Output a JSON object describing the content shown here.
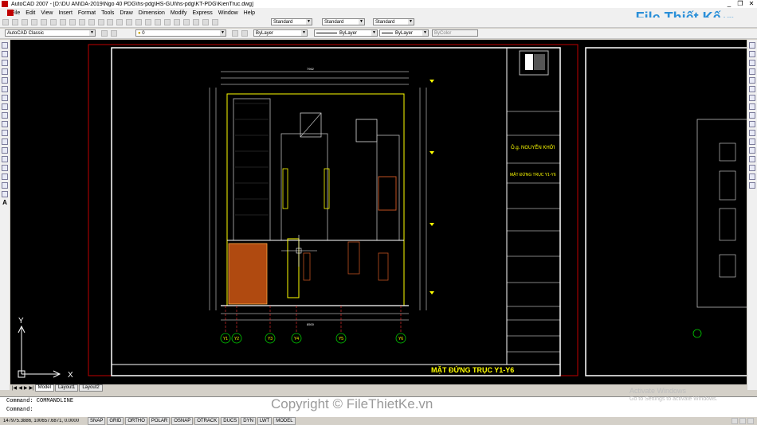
{
  "window": {
    "title": "AutoCAD 2007 - [D:\\DU AN\\DA-2019\\Ngo 40 PDG\\hs-pdg\\HS-GUI\\hs-pdg\\KT-PDG\\KienTruc.dwg]",
    "minimize": "_",
    "restore": "❐",
    "close": "✕"
  },
  "menu": [
    "File",
    "Edit",
    "View",
    "Insert",
    "Format",
    "Tools",
    "Draw",
    "Dimension",
    "Modify",
    "Express",
    "Window",
    "Help"
  ],
  "toolbar2": {
    "workspace": "AutoCAD Classic",
    "layer": "0",
    "text_style": "Standard",
    "dim_style": "Standard",
    "table_style": "Standard"
  },
  "toolbar3": {
    "color": "ByLayer",
    "linetype": "ByLayer",
    "lineweight": "ByLayer",
    "plotstyle": "ByColor"
  },
  "logo": {
    "brand": "File Thiết Kế",
    "tld": ".vn"
  },
  "drawing": {
    "sheet_title": "MẶT ĐỨNG TRỤC Y1-Y6",
    "owner_name": "Ô.g. NGUYỄN KHỞI",
    "tb_title": "MẶT ĐỨNG TRỤC Y1-Y6",
    "axes": [
      "Y1",
      "Y2",
      "Y3",
      "Y4",
      "Y5",
      "Y6"
    ],
    "axis_x": "X",
    "axis_y": "Y",
    "top_dim": "7962",
    "bottom_dim": "8500"
  },
  "tabs": [
    "Model",
    "Layout1",
    "Layout2"
  ],
  "command": {
    "line1": "Command: COMMANDLINE",
    "line2": "Command:"
  },
  "watermark": {
    "copyright": "Copyright © FileThietKe.vn",
    "activate": "Activate Windows",
    "activate_sub": "Go to Settings to activate Windows."
  },
  "status": {
    "coords": "147975.3886, 100657.6871, 0.0000",
    "toggles": [
      "SNAP",
      "GRID",
      "ORTHO",
      "POLAR",
      "OSNAP",
      "OTRACK",
      "DUCS",
      "DYN",
      "LWT",
      "MODEL"
    ]
  }
}
